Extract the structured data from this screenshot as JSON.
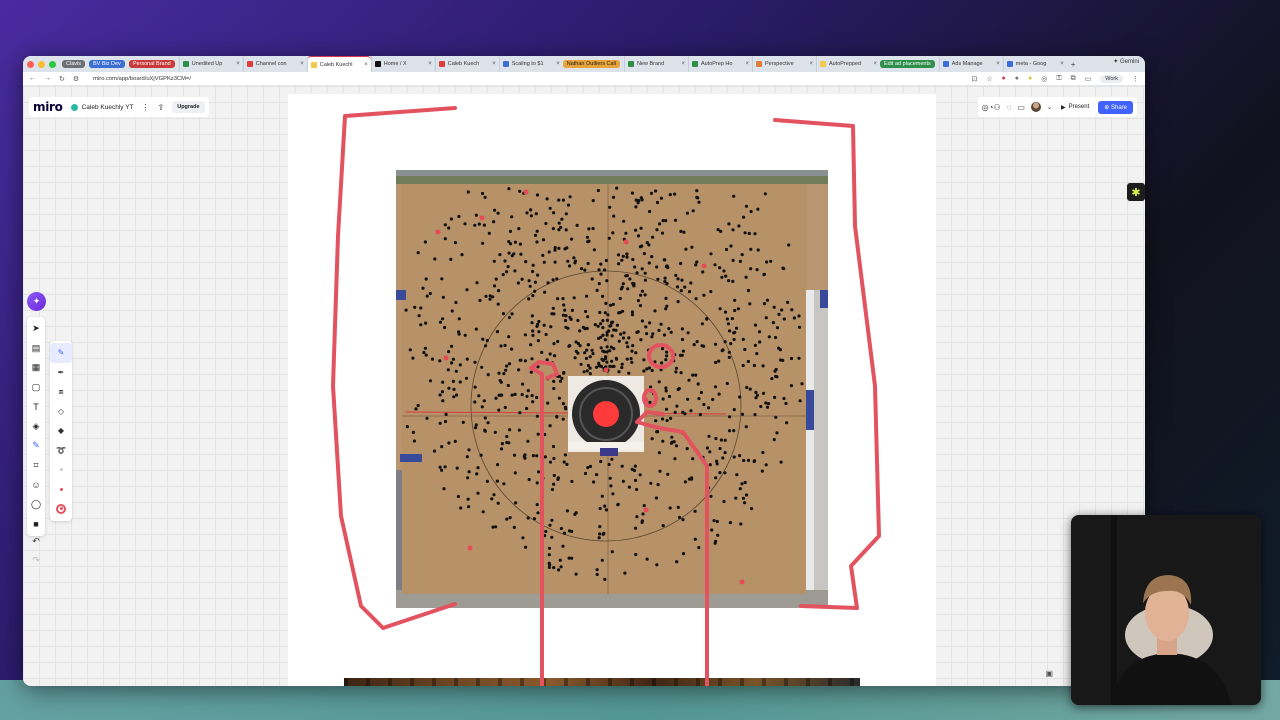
{
  "browser": {
    "tab_groups": [
      {
        "label": "Clavis",
        "color": "#6b6f76"
      },
      {
        "label": "BV Biz Dev",
        "color": "#3b6fd6"
      },
      {
        "label": "Personal Brand",
        "color": "#c93a3a"
      }
    ],
    "tabs": [
      {
        "title": "Unedited Up",
        "fav": "#2f8f4a"
      },
      {
        "title": "Channel con",
        "fav": "#e23b3b"
      },
      {
        "title": "Caleb Kuechl",
        "fav": "#f2c94c",
        "active": true
      },
      {
        "title": "Home / X",
        "fav": "#111111"
      },
      {
        "title": "Caleb Kuech",
        "fav": "#e23b3b"
      },
      {
        "title": "Scaling to $1",
        "fav": "#3b6fd6"
      }
    ],
    "tab_group_2": {
      "label": "Nathan Outliers Call",
      "color": "#e8a43a"
    },
    "tabs_2": [
      {
        "title": "New Brand",
        "fav": "#2f8f4a"
      },
      {
        "title": "AutoPrep Ho",
        "fav": "#2f8f4a"
      },
      {
        "title": "Perspective",
        "fav": "#e07b39"
      },
      {
        "title": "AutoPrepped",
        "fav": "#f2c94c"
      }
    ],
    "tab_group_3": {
      "label": "Edit ad placements",
      "color": "#2f8f4a"
    },
    "tabs_3": [
      {
        "title": "Ads Manage",
        "fav": "#3b6fd6"
      },
      {
        "title": "meta - Goog",
        "fav": "#3b6fd6"
      }
    ],
    "gemini_label": "Gemini",
    "url": "miro.com/app/board/uXjVGPKz3CM=/",
    "profile_label": "Work"
  },
  "miro": {
    "logo": "miro",
    "board_name": "Caleb Kuechly YT",
    "upgrade_label": "Upgrade",
    "present_label": "Present",
    "share_label": "Share",
    "colors": {
      "accent": "#4262ff",
      "pen": "#e2525f"
    }
  },
  "toolbar": {
    "items": [
      "select-icon",
      "templates-icon",
      "table-icon",
      "sticky-note-icon",
      "text-icon",
      "shapes-icon",
      "pen-icon",
      "frame-icon",
      "emoji-icon",
      "comment-icon",
      "more-icon"
    ],
    "pen_tools": [
      "pen-icon",
      "marker-icon",
      "highlighter-icon",
      "eraser-icon",
      "eraser-alt-icon",
      "lasso-icon"
    ]
  }
}
